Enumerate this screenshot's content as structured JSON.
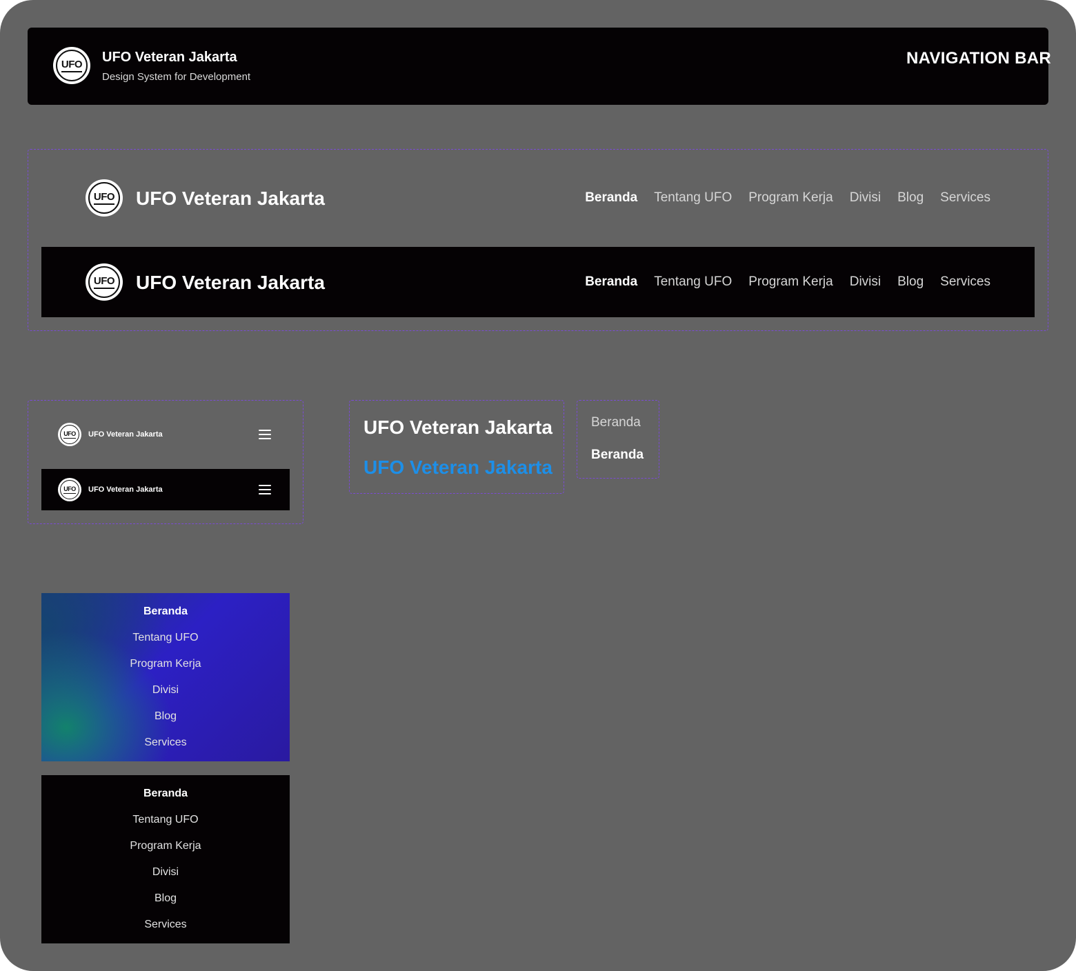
{
  "header": {
    "logo_text": "UFO",
    "title": "UFO Veteran Jakarta",
    "subtitle": "Design System for Development",
    "section_label": "NAVIGATION BAR"
  },
  "desktop_nav_light": {
    "logo_text": "UFO",
    "brand": "UFO Veteran Jakarta",
    "items": [
      {
        "label": "Beranda",
        "active": true
      },
      {
        "label": "Tentang UFO",
        "active": false
      },
      {
        "label": "Program Kerja",
        "active": false
      },
      {
        "label": "Divisi",
        "active": false
      },
      {
        "label": "Blog",
        "active": false
      },
      {
        "label": "Services",
        "active": false
      }
    ]
  },
  "desktop_nav_dark": {
    "logo_text": "UFO",
    "brand": "UFO Veteran Jakarta",
    "items": [
      {
        "label": "Beranda",
        "active": true
      },
      {
        "label": "Tentang UFO",
        "active": false
      },
      {
        "label": "Program Kerja",
        "active": false
      },
      {
        "label": "Divisi",
        "active": false
      },
      {
        "label": "Blog",
        "active": false
      },
      {
        "label": "Services",
        "active": false
      }
    ]
  },
  "mobile_nav_light": {
    "logo_text": "UFO",
    "brand": "UFO Veteran Jakarta",
    "menu_icon": "hamburger-icon"
  },
  "mobile_nav_dark": {
    "logo_text": "UFO",
    "brand": "UFO Veteran Jakarta",
    "menu_icon": "hamburger-icon"
  },
  "brand_states": {
    "default": "UFO Veteran Jakarta",
    "hover": "UFO Veteran Jakarta",
    "hover_color": "#1d8fe8"
  },
  "link_states": {
    "default": "Beranda",
    "active": "Beranda"
  },
  "mobile_menu_gradient": {
    "items": [
      {
        "label": "Beranda",
        "active": true
      },
      {
        "label": "Tentang UFO",
        "active": false
      },
      {
        "label": "Program Kerja",
        "active": false
      },
      {
        "label": "Divisi",
        "active": false
      },
      {
        "label": "Blog",
        "active": false
      },
      {
        "label": "Services",
        "active": false
      }
    ]
  },
  "mobile_menu_dark": {
    "items": [
      {
        "label": "Beranda",
        "active": true
      },
      {
        "label": "Tentang UFO",
        "active": false
      },
      {
        "label": "Program Kerja",
        "active": false
      },
      {
        "label": "Divisi",
        "active": false
      },
      {
        "label": "Blog",
        "active": false
      },
      {
        "label": "Services",
        "active": false
      }
    ]
  },
  "colors": {
    "canvas": "#636363",
    "dark": "#050204",
    "dashed_border": "#7b4bd6",
    "accent_blue": "#1d8fe8"
  }
}
